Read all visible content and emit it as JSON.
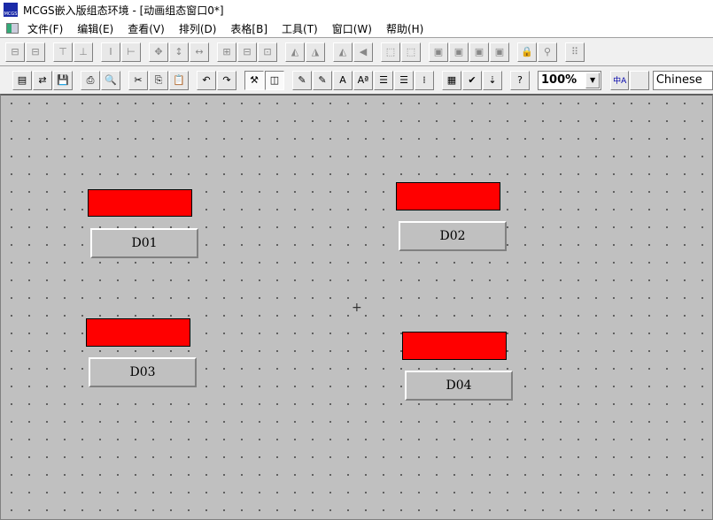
{
  "window": {
    "title": "MCGS嵌入版组态环境 - [动画组态窗口0*]"
  },
  "menu": [
    "文件(F)",
    "编辑(E)",
    "查看(V)",
    "排列(D)",
    "表格[B]",
    "工具(T)",
    "窗口(W)",
    "帮助(H)"
  ],
  "toolbar1": {
    "groups": [
      [
        "⊟",
        "⊟"
      ],
      [
        "⊤",
        "⊥"
      ],
      [
        "Ⅰ",
        "⊢"
      ],
      [
        "✥",
        "↕",
        "↔"
      ],
      [
        "⊞",
        "⊟",
        "⊡"
      ],
      [
        "◭",
        "◮"
      ],
      [
        "◭",
        "◀"
      ],
      [
        "⬚",
        "⬚"
      ],
      [
        "▣",
        "▣",
        "▣",
        "▣"
      ],
      [
        "🔒",
        "⚲"
      ],
      [
        "⠿"
      ]
    ]
  },
  "toolbar2": {
    "groups": [
      [
        "▤",
        "⇄",
        "💾"
      ],
      [
        "⎙",
        "🔍"
      ],
      [
        "✂",
        "⎘",
        "📋"
      ],
      [
        "↶",
        "↷"
      ],
      [
        "⚒",
        "◫"
      ],
      [
        "✎",
        "✎",
        "A",
        "Aª",
        "☰",
        "☰",
        "⁞"
      ],
      [
        "▦",
        "✔",
        "⇣"
      ],
      [
        "?"
      ]
    ],
    "zoom_value": "100%",
    "language_value": "Chinese",
    "lang_icon": "中A"
  },
  "canvas": {
    "lamps": [
      {
        "name": "lamp-1",
        "color": "#ff0000"
      },
      {
        "name": "lamp-2",
        "color": "#ff0000"
      },
      {
        "name": "lamp-3",
        "color": "#ff0000"
      },
      {
        "name": "lamp-4",
        "color": "#ff0000"
      }
    ],
    "buttons": [
      "D01",
      "D02",
      "D03",
      "D04"
    ],
    "cursor": "+"
  }
}
